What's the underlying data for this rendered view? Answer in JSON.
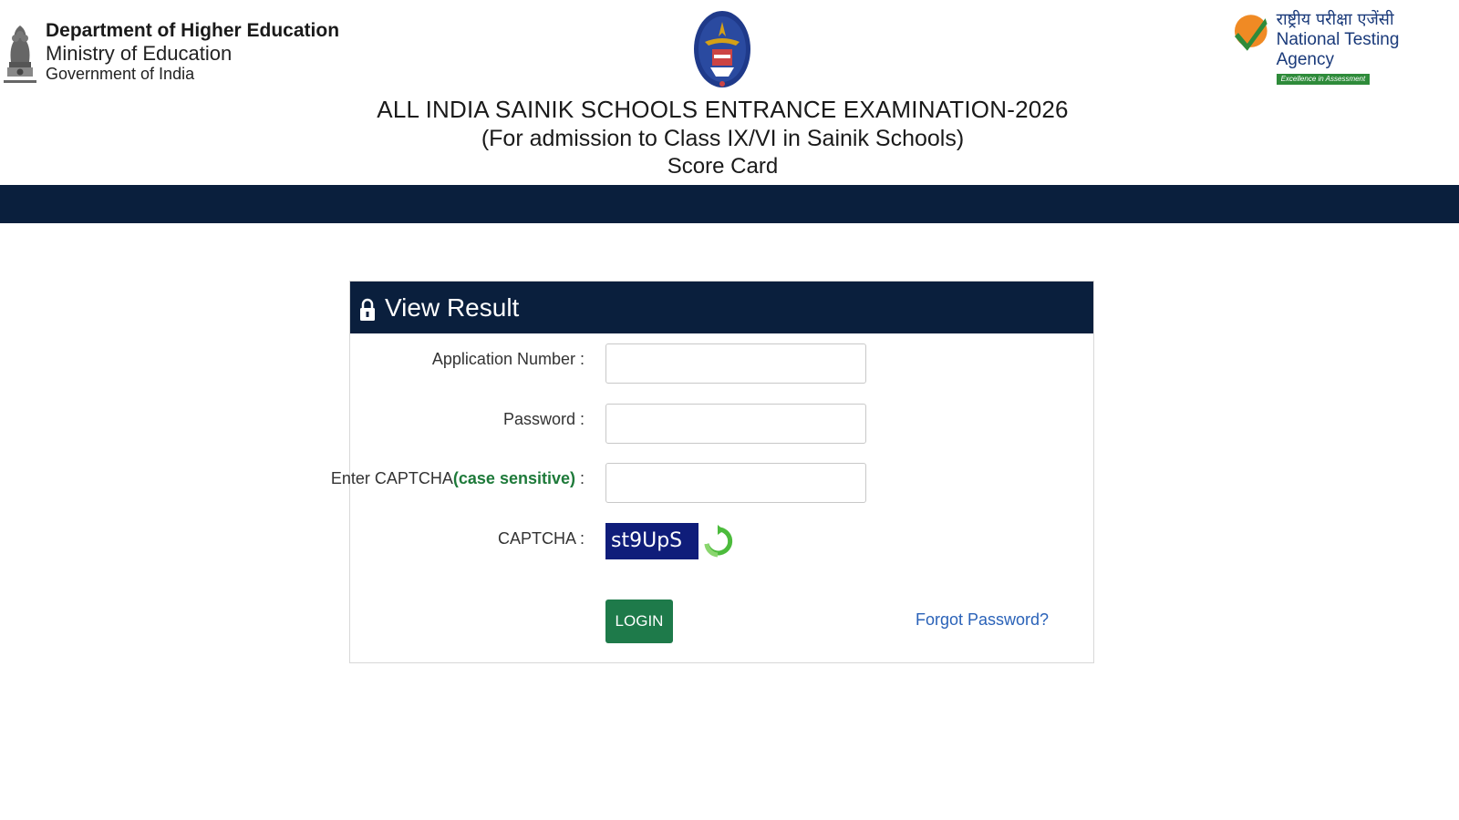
{
  "header": {
    "govt": {
      "line1": "Department of Higher Education",
      "line2": "Ministry of Education",
      "line3": "Government of India"
    },
    "title": {
      "line1": "ALL INDIA SAINIK SCHOOLS ENTRANCE EXAMINATION-2026",
      "line2": "(For admission to Class IX/VI in Sainik Schools)",
      "line3": "Score Card"
    },
    "nta": {
      "hindi": "राष्ट्रीय परीक्षा एजेंसी",
      "english": "National Testing Agency",
      "tagline": "Excellence in Assessment"
    }
  },
  "panel": {
    "title": "View Result",
    "fields": {
      "application_label": "Application Number :",
      "password_label": "Password :",
      "captcha_input_label_prefix": "Enter CAPTCHA",
      "captcha_input_label_emph": "(case sensitive)",
      "captcha_input_label_suffix": " :",
      "captcha_label": "CAPTCHA :",
      "captcha_value": "st9UpS",
      "application_value": "",
      "password_value": "",
      "captcha_input_value": ""
    },
    "login_label": "LOGIN",
    "forgot_label": "Forgot Password?"
  },
  "colors": {
    "navy": "#0a1f3d",
    "login_green": "#1e7a4a",
    "link_blue": "#2a62b8",
    "captcha_bg": "#0f1d7a"
  }
}
